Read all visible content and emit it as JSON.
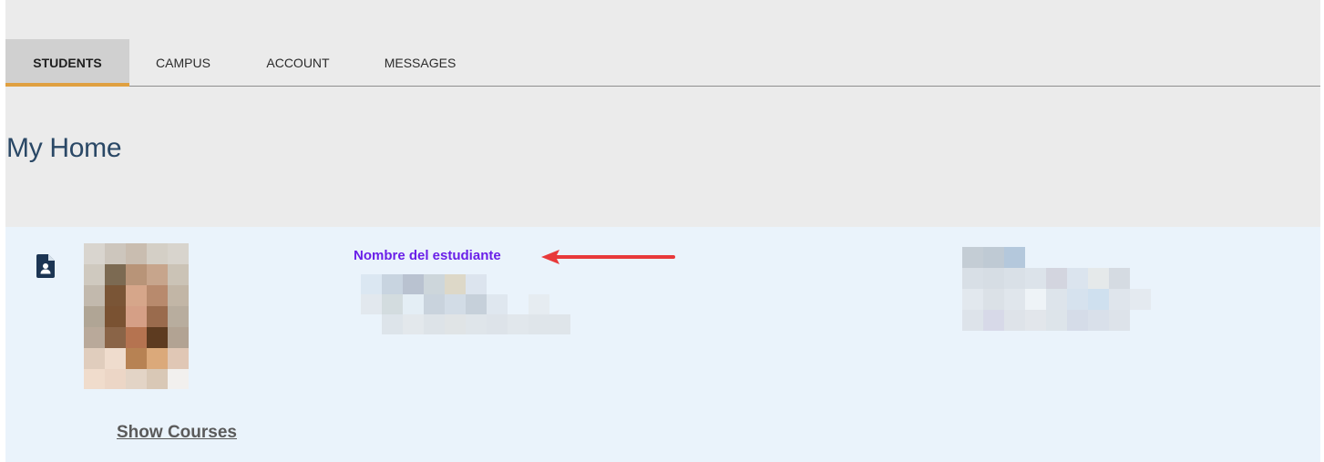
{
  "nav": {
    "tabs": [
      {
        "label": "STUDENTS",
        "active": true
      },
      {
        "label": "CAMPUS",
        "active": false
      },
      {
        "label": "ACCOUNT",
        "active": false
      },
      {
        "label": "MESSAGES",
        "active": false
      }
    ]
  },
  "page": {
    "title": "My Home"
  },
  "student_card": {
    "icon": "student-id-icon",
    "photo": "student-photo-pixelated",
    "annotation_label": "Nombre del estudiante",
    "annotation_color": "#6a1fe8",
    "arrow_color": "#e8393a",
    "show_courses_label": "Show Courses"
  },
  "colors": {
    "accent_tab_underline": "#e0a040",
    "title_color": "#2a4866",
    "card_bg": "#eaf3fb",
    "shell_bg": "#ebebeb"
  }
}
